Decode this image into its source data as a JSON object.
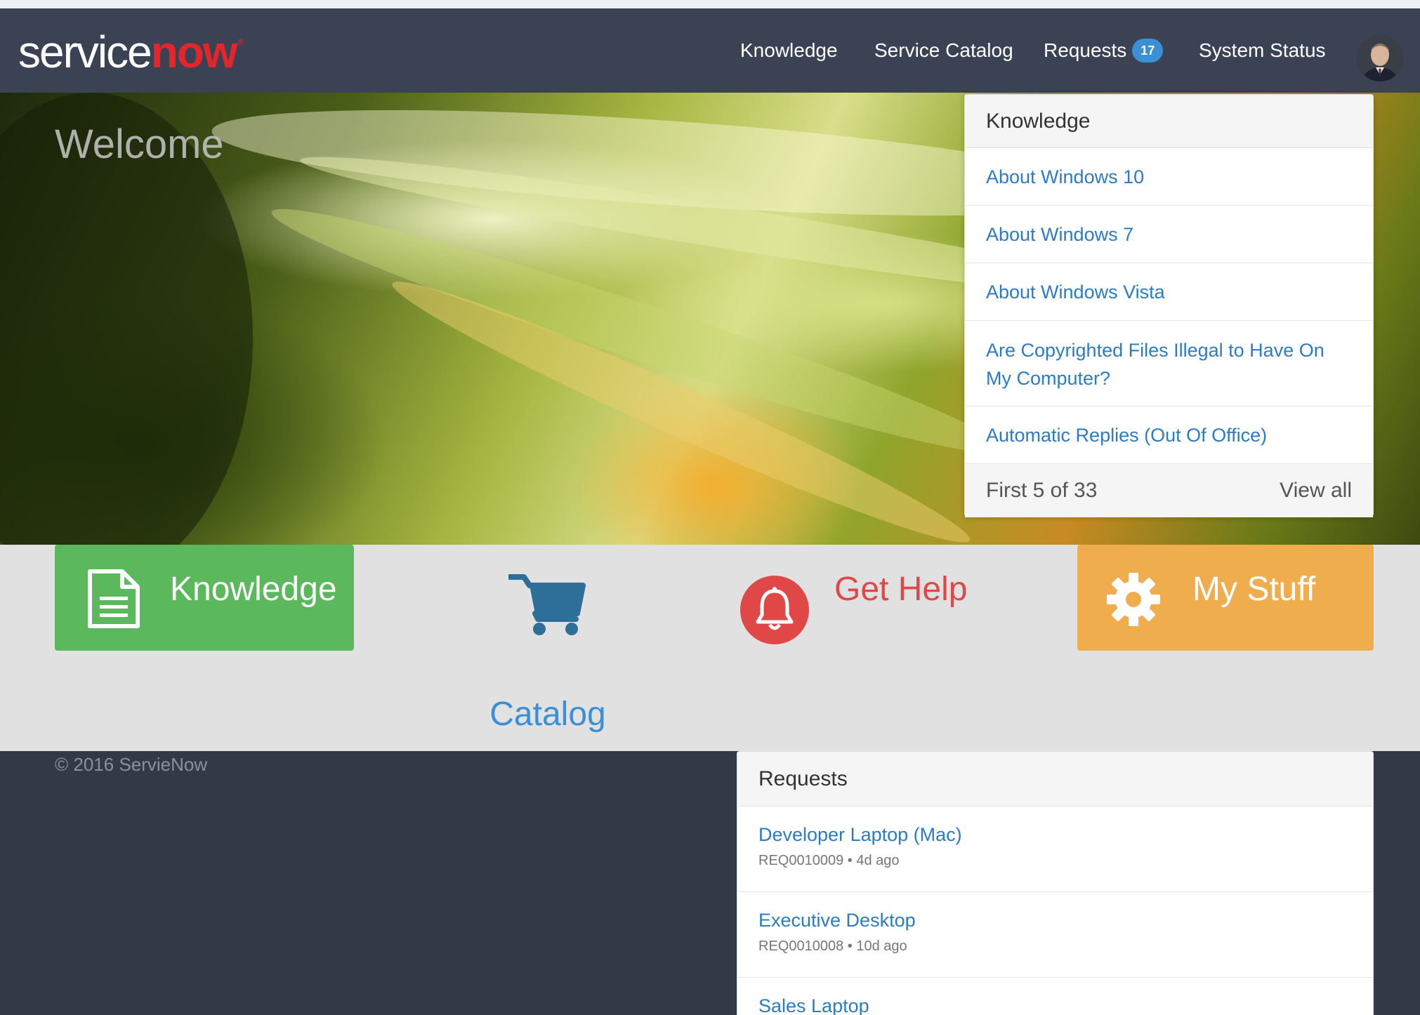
{
  "brand": {
    "logo_part1": "service",
    "logo_part2": "now",
    "logo_mark": "®",
    "accent_red": "#e4262c"
  },
  "nav": {
    "items": [
      {
        "label": "Knowledge"
      },
      {
        "label": "Service Catalog"
      },
      {
        "label": "Requests",
        "badge": "17"
      },
      {
        "label": "System Status"
      }
    ],
    "avatar_icon": "user-avatar"
  },
  "hero": {
    "welcome": "Welcome"
  },
  "knowledge_panel": {
    "title": "Knowledge",
    "articles": [
      "About Windows 10",
      "About Windows 7",
      "About Windows Vista",
      "Are Copyrighted Files Illegal to Have On My Computer?",
      "Automatic Replies (Out Of Office)"
    ],
    "count_text": "First 5 of 33",
    "view_all": "View all"
  },
  "tiles": {
    "knowledge": {
      "label": "Knowledge",
      "icon": "document-icon",
      "color": "#5cb85c"
    },
    "catalog": {
      "label": "Catalog",
      "icon": "cart-icon",
      "color": "#3b8fd5"
    },
    "get_help": {
      "label": "Get Help",
      "icon": "bell-icon",
      "color": "#e04848"
    },
    "my_stuff": {
      "label": "My Stuff",
      "icon": "gear-icon",
      "color": "#f0ad4e"
    }
  },
  "footer": {
    "copyright": "© 2016 ServieNow"
  },
  "requests_panel": {
    "title": "Requests",
    "items": [
      {
        "title": "Developer Laptop (Mac)",
        "number": "REQ0010009",
        "age": "4d ago"
      },
      {
        "title": "Executive Desktop",
        "number": "REQ0010008",
        "age": "10d ago"
      },
      {
        "title": "Sales Laptop"
      }
    ],
    "separator": "•"
  }
}
